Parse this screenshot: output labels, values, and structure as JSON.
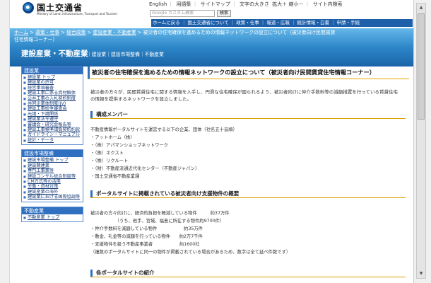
{
  "header": {
    "logo_text": "国土交通省",
    "logo_en": "Ministry of Land, Infrastructure, Transport and Tourism",
    "top_links": [
      "English",
      "用語集",
      "サイトマップ",
      "文字の大きさ",
      "拡大＋ 縮小－",
      "サイト内検索"
    ],
    "search_placeholder": "Google カスタム検索",
    "search_button": "検索",
    "nav": [
      "ホームに戻る",
      "国土交通省について",
      "政策・仕事",
      "報道・広報",
      "統計情報・白書",
      "申請・手続"
    ]
  },
  "breadcrumb": {
    "items": [
      "ホーム",
      "政策・仕事",
      "総合政策",
      "建設産業・不動産業",
      "被災者の住宅確保を進めるための情報ネットワークの設立について（被災者向け民間賃貸住宅情報コーナー）"
    ]
  },
  "section": {
    "title": "建設産業・不動産業",
    "subtitle": "｜建設業｜建設市場整備｜不動産業"
  },
  "sidebar": {
    "boxes": [
      {
        "heading": "建設業",
        "items": [
          "建設業 トップ",
          "建設業の許可",
          "経営事項審査",
          "建設工事に係る資材解体",
          "公共工事の入札契約制度",
          "共同企業体制度(JV)",
          "建設工事紛争審査会",
          "元請・下請関係",
          "建設業法令遵守",
          "審議会・研究会報告等",
          "建設工事標準請負契約約款",
          "ガイドライン・マニュアル",
          "統計・データ"
        ]
      },
      {
        "heading": "建設市場整備",
        "items": [
          "建設市場整備 トップ",
          "建設関連業",
          "専門工事業等",
          "建設コンサル総合制度等",
          "CM方式等の活用",
          "労働・資材対策",
          "建設産業の海外",
          "建設業における国際協調等"
        ]
      },
      {
        "heading": "不動産業",
        "items": [
          "不動産業 トップ"
        ]
      }
    ]
  },
  "main": {
    "page_title": "被災者の住宅確保を進めるための情報ネットワークの設立について（被災者向け民間賃貸住宅情報コーナー）",
    "intro_lines": [
      "被災者の方々が、民間賃貸住宅に関する情報を入手し、円滑な住宅確保が図られるよう、被災者向けに仲介手数料等の減額措置を行っている賃貸住宅",
      "の情報を提供するネットワークを設立しました。"
    ],
    "section1_title": "構成メンバー",
    "section1_lines": [
      "不動産情報ポータルサイトを運営する以下の企業、団体（社名五十音順）",
      "・アットホーム（株）",
      "・（株）アパマンショップネットワーク",
      "・（株）ネクスト",
      "・（株）リクルート",
      "・（財）不動産流通近代化センター（不動産ジャパン）",
      "・国土交通省不動産業課"
    ],
    "section2_title": "ポータルサイトに掲載されている被災者向け支援物件の概要",
    "section2_lines": [
      "被災者の方々向けに、経済的負担を軽減している物件　　　約37万件",
      "　　　　　　（うち、岩手、宮城、福島に所在する物件約9700件）",
      "・仲介手数料を減額している物件　　　　　　約35万件",
      "・敷金、礼金等の減額を行っている物件　　約2万7千件",
      "・支援物件を扱う不動産事業者　　　　　　約1600社",
      "（複数のポータルサイトに同一の物件が掲載されている場合があるため、数字は全て延べ件数です）"
    ],
    "section3_title": "各ポータルサイトの紹介"
  }
}
